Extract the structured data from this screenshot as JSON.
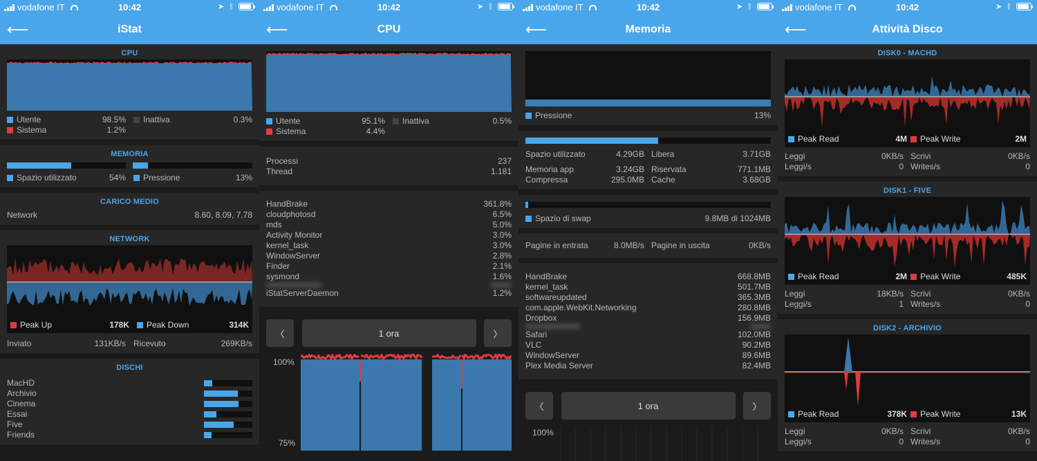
{
  "status": {
    "carrier": "vodafone IT",
    "time": "10:42"
  },
  "colors": {
    "accent": "#4aa6ea",
    "system": "#e03c3c"
  },
  "icons": {
    "back": "arrow-left-icon",
    "location": "location-arrow-icon",
    "bluetooth": "bluetooth-icon",
    "battery": "battery-icon",
    "prev": "chevron-left-icon",
    "next": "chevron-right-icon"
  },
  "istat": {
    "title": "iStat",
    "cpu": {
      "header": "CPU",
      "user_label": "Utente",
      "user": "98.5%",
      "system_label": "Sistema",
      "system": "1.2%",
      "idle_label": "Inattiva",
      "idle": "0.3%"
    },
    "memory": {
      "header": "MEMORIA",
      "used_label": "Spazio utilizzato",
      "used": "54%",
      "used_fill": 0.54,
      "pressure_label": "Pressione",
      "pressure": "13%",
      "pressure_fill": 0.13
    },
    "load": {
      "header": "CARICO MEDIO",
      "label": "Network",
      "value": "8.60, 8.09, 7.78"
    },
    "network": {
      "header": "NETWORK",
      "peak_up_label": "Peak Up",
      "peak_up": "178K",
      "peak_down_label": "Peak Down",
      "peak_down": "314K",
      "sent_label": "Inviato",
      "sent": "131KB/s",
      "recv_label": "Ricevuto",
      "recv": "269KB/s"
    },
    "disks": {
      "header": "DISCHI",
      "items": [
        {
          "name": "MacHD",
          "fill": 0.17
        },
        {
          "name": "Archivio",
          "fill": 0.7
        },
        {
          "name": "Cinema",
          "fill": 0.72
        },
        {
          "name": "Essai",
          "fill": 0.26
        },
        {
          "name": "Five",
          "fill": 0.61
        },
        {
          "name": "Friends",
          "fill": 0.15
        }
      ]
    }
  },
  "cpu": {
    "title": "CPU",
    "user_label": "Utente",
    "user": "95.1%",
    "system_label": "Sistema",
    "system": "4.4%",
    "idle_label": "Inattiva",
    "idle": "0.5%",
    "processes_label": "Processi",
    "processes": "237",
    "threads_label": "Thread",
    "threads": "1.181",
    "top": [
      {
        "name": "HandBrake",
        "value": "361.8%"
      },
      {
        "name": "cloudphotosd",
        "value": "6.5%"
      },
      {
        "name": "mds",
        "value": "5.0%"
      },
      {
        "name": "Activity Monitor",
        "value": "3.0%"
      },
      {
        "name": "kernel_task",
        "value": "3.0%"
      },
      {
        "name": "WindowServer",
        "value": "2.8%"
      },
      {
        "name": "Finder",
        "value": "2.1%"
      },
      {
        "name": "sysmond",
        "value": "1.6%"
      },
      {
        "name": "",
        "value": "",
        "blurred": true
      },
      {
        "name": "iStatServerDaemon",
        "value": "1.2%"
      }
    ],
    "range": "1 ora",
    "tick_100": "100%",
    "tick_75": "75%"
  },
  "memoria": {
    "title": "Memoria",
    "pressure_label": "Pressione",
    "pressure": "13%",
    "used_label": "Spazio utilizzato",
    "used": "4.29GB",
    "used_fill": 0.54,
    "free_label": "Libera",
    "free": "3.71GB",
    "app_label": "Memoria app",
    "app": "3.24GB",
    "wired_label": "Riservata",
    "wired": "771.1MB",
    "comp_label": "Compressa",
    "comp": "295.0MB",
    "cache_label": "Cache",
    "cache": "3.68GB",
    "swap_label": "Spazio di swap",
    "swap": "9.8MB di 1024MB",
    "swap_fill": 0.01,
    "pagein_label": "Pagine in entrata",
    "pagein": "8.0MB/s",
    "pageout_label": "Pagine in uscita",
    "pageout": "0KB/s",
    "top": [
      {
        "name": "HandBrake",
        "value": "668.8MB"
      },
      {
        "name": "kernel_task",
        "value": "501.7MB"
      },
      {
        "name": "softwareupdated",
        "value": "365.3MB"
      },
      {
        "name": "com.apple.WebKit.Networking",
        "value": "280.8MB"
      },
      {
        "name": "Dropbox",
        "value": "156.9MB"
      },
      {
        "name": "",
        "value": "",
        "blurred": true
      },
      {
        "name": "Safari",
        "value": "102.0MB"
      },
      {
        "name": "VLC",
        "value": "90.2MB"
      },
      {
        "name": "WindowServer",
        "value": "89.6MB"
      },
      {
        "name": "Plex Media Server",
        "value": "82.4MB"
      }
    ],
    "range": "1 ora",
    "tick_100": "100%"
  },
  "disco": {
    "title": "Attività Disco",
    "disks": [
      {
        "header": "DISK0 - MACHD",
        "peak_read_label": "Peak Read",
        "peak_read": "4M",
        "peak_write_label": "Peak Write",
        "peak_write": "2M",
        "read_label": "Leggi",
        "read": "0KB/s",
        "write_label": "Scrivi",
        "write": "0KB/s",
        "reads_label": "Leggi/s",
        "reads": "0",
        "writes_label": "Writes/s",
        "writes": "0"
      },
      {
        "header": "DISK1 - FIVE",
        "peak_read_label": "Peak Read",
        "peak_read": "2M",
        "peak_write_label": "Peak Write",
        "peak_write": "485K",
        "read_label": "Leggi",
        "read": "18KB/s",
        "write_label": "Scrivi",
        "write": "0KB/s",
        "reads_label": "Leggi/s",
        "reads": "1",
        "writes_label": "Writes/s",
        "writes": "0"
      },
      {
        "header": "DISK2 - ARCHIVIO",
        "peak_read_label": "Peak Read",
        "peak_read": "378K",
        "peak_write_label": "Peak Write",
        "peak_write": "13K",
        "read_label": "Leggi",
        "read": "0KB/s",
        "write_label": "Scrivi",
        "write": "0KB/s",
        "reads_label": "Leggi/s",
        "reads": "0",
        "writes_label": "Writes/s",
        "writes": "0"
      }
    ]
  }
}
